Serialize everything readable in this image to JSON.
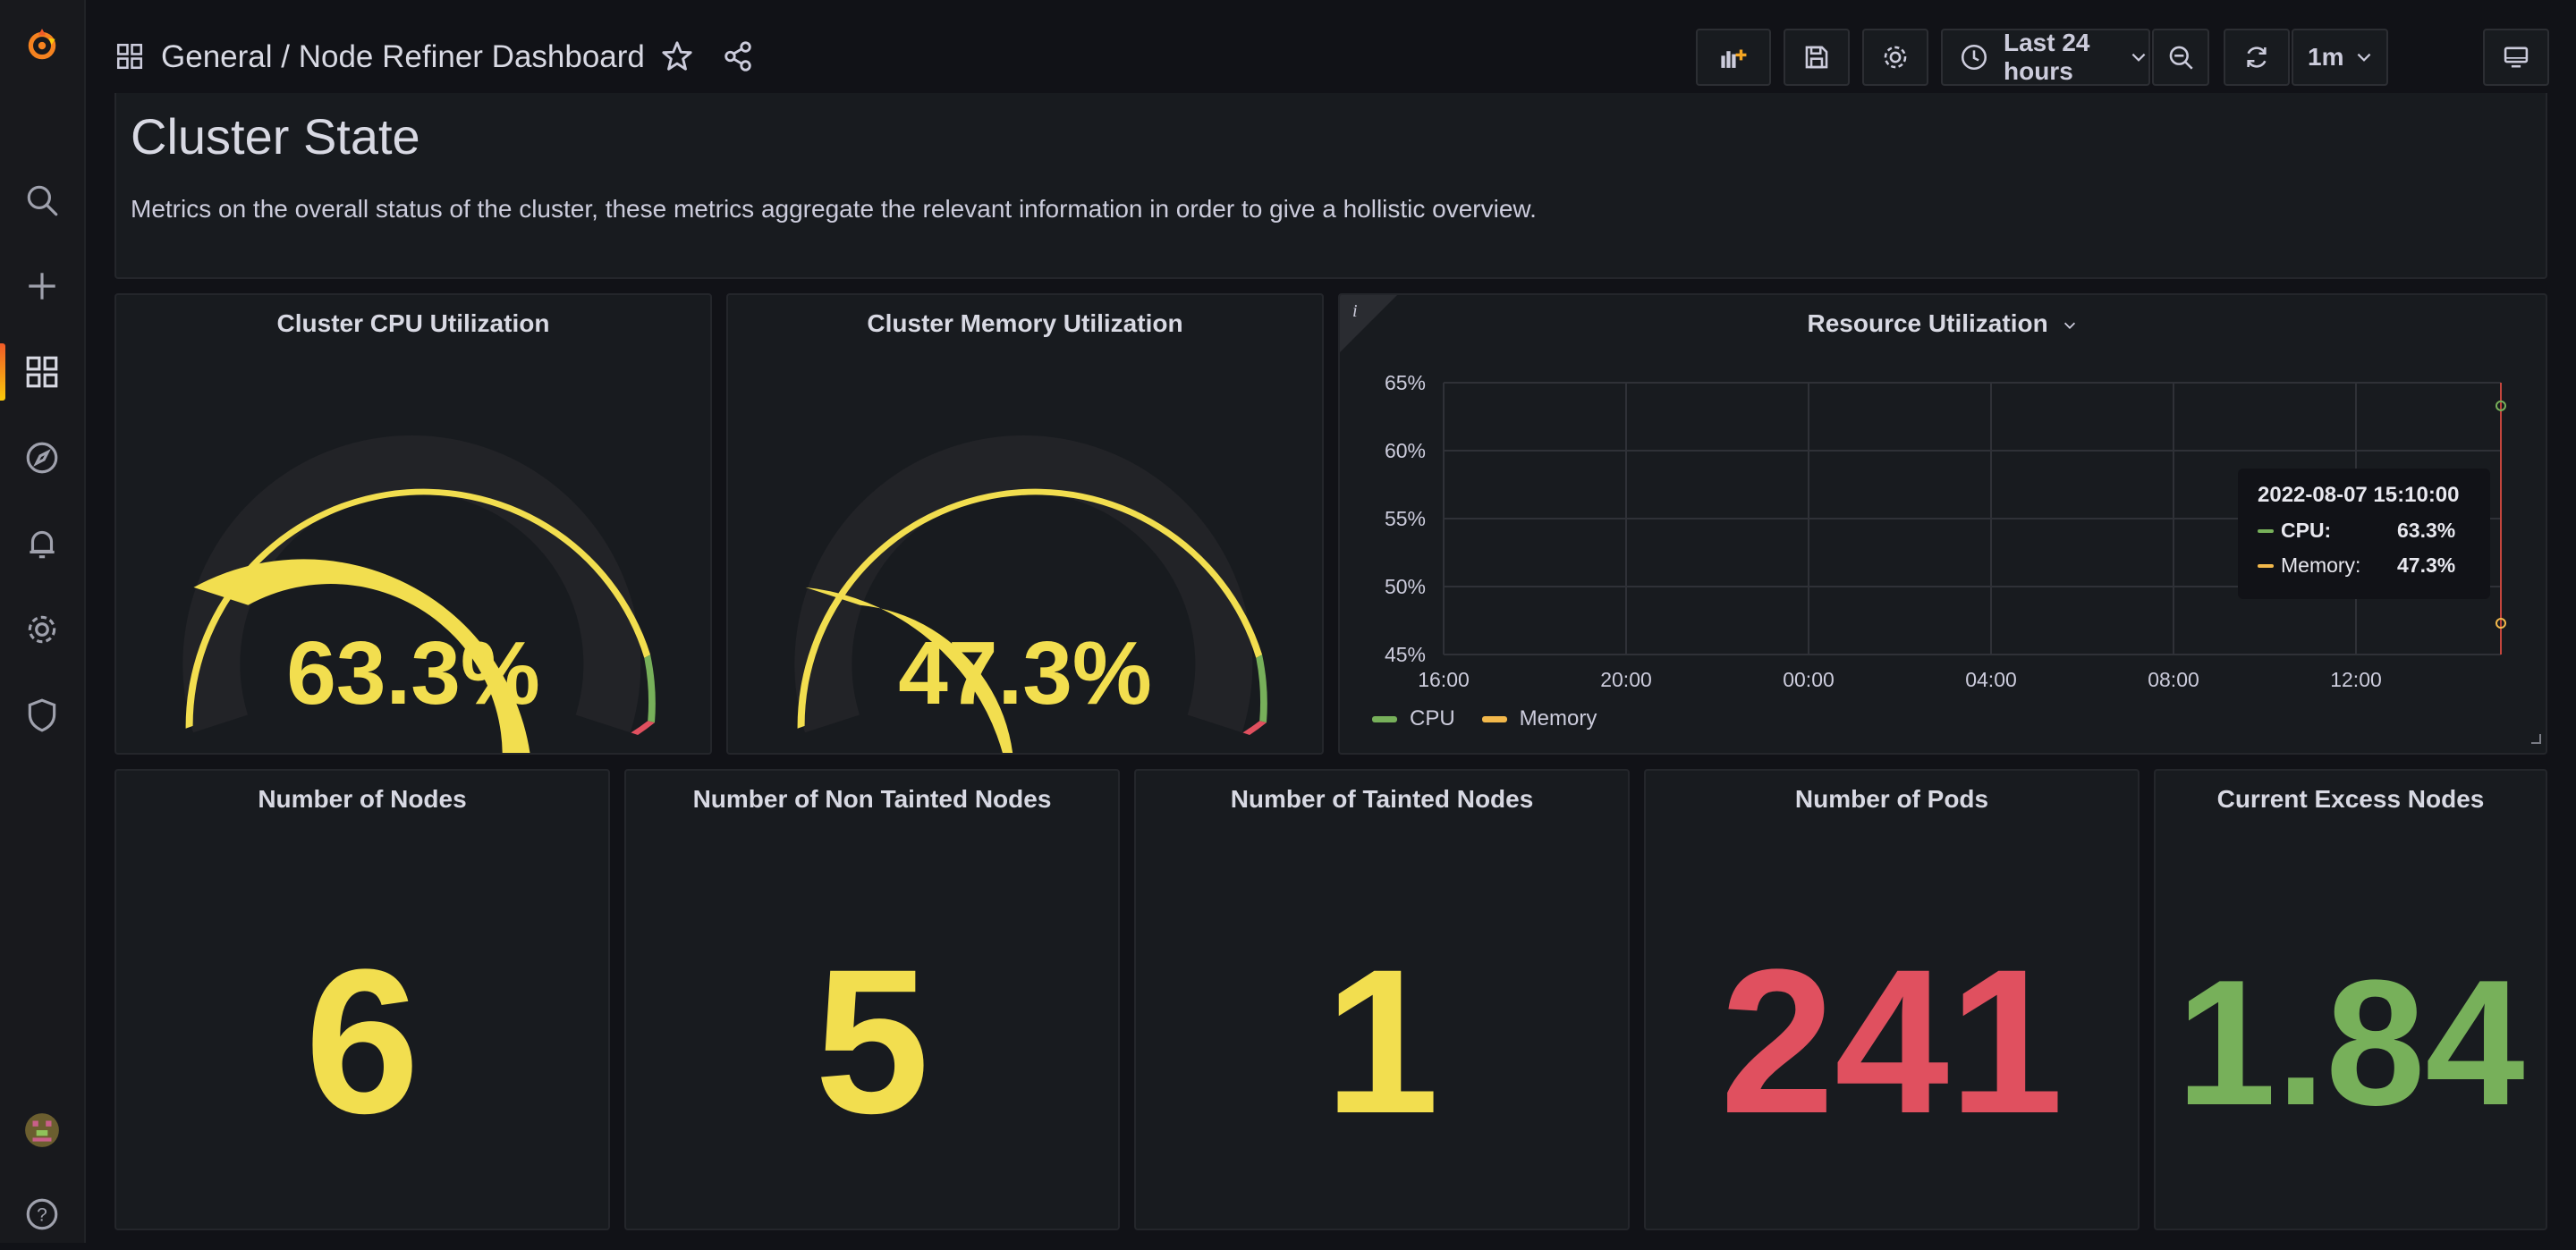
{
  "breadcrumb": {
    "folder": "General",
    "separator": " / ",
    "dashboard": "Node Refiner Dashboard"
  },
  "toolbar": {
    "time_range": "Last 24 hours",
    "refresh_interval": "1m"
  },
  "text_panel": {
    "title": "Cluster State",
    "description": "Metrics on the overall status of the cluster, these metrics aggregate the relevant information in order to give a hollistic overview."
  },
  "gauges": [
    {
      "title": "Cluster CPU Utilization",
      "display": "63.3%",
      "value": 63.3
    },
    {
      "title": "Cluster Memory Utilization",
      "display": "47.3%",
      "value": 47.3
    }
  ],
  "resource_panel": {
    "title": "Resource Utilization",
    "y_ticks": [
      "65%",
      "60%",
      "55%",
      "50%",
      "45%"
    ],
    "x_ticks": [
      "16:00",
      "20:00",
      "00:00",
      "04:00",
      "08:00",
      "12:00"
    ],
    "legend": [
      "CPU",
      "Memory"
    ],
    "tooltip": {
      "time": "2022-08-07 15:10:00",
      "rows": [
        {
          "label": "CPU:",
          "value": "63.3%"
        },
        {
          "label": "Memory:",
          "value": "47.3%"
        }
      ]
    }
  },
  "chart_data": {
    "type": "line",
    "title": "Resource Utilization",
    "xlabel": "",
    "ylabel": "",
    "ylim": [
      45,
      65
    ],
    "x": [
      "2022-08-07 15:10:00"
    ],
    "series": [
      {
        "name": "CPU",
        "values": [
          63.3
        ]
      },
      {
        "name": "Memory",
        "values": [
          47.3
        ]
      }
    ],
    "grid": true,
    "legend_position": "bottom-left"
  },
  "stats": [
    {
      "title": "Number of Nodes",
      "value": "6",
      "color": "#f2de4f"
    },
    {
      "title": "Number of Non Tainted Nodes",
      "value": "5",
      "color": "#f2de4f"
    },
    {
      "title": "Number of Tainted Nodes",
      "value": "1",
      "color": "#f2de4f"
    },
    {
      "title": "Number of Pods",
      "value": "241",
      "color": "#e0505f"
    },
    {
      "title": "Current Excess Nodes",
      "value": "1.84",
      "color": "#77b05a"
    }
  ],
  "colors": {
    "yellow": "#f2de4f",
    "green": "#77b05a",
    "red": "#e0505f",
    "cpu_series": "#77b05a",
    "memory_series": "#f2b84b"
  },
  "icons": [
    "grafana-logo-icon",
    "search-icon",
    "plus-icon",
    "dashboards-icon",
    "explore-icon",
    "bell-icon",
    "gear-icon",
    "shield-icon",
    "avatar",
    "help-icon"
  ]
}
